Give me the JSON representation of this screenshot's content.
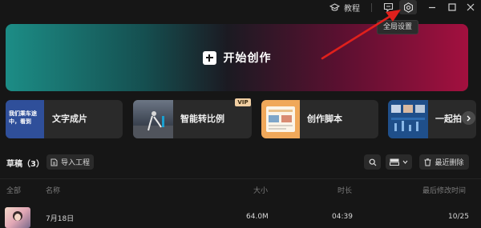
{
  "topbar": {
    "tutorial_label": "教程",
    "tooltip": "全局设置"
  },
  "banner": {
    "label": "开始创作"
  },
  "features": [
    {
      "thumb_text": "我们乘车途中，看到",
      "label": "文字成片"
    },
    {
      "label": "智能转比例",
      "badge": "VIP"
    },
    {
      "label": "创作脚本"
    },
    {
      "label": "一起拍"
    }
  ],
  "drafts": {
    "title": "草稿（3）",
    "import_label": "导入工程",
    "recent_delete_label": "最近删除"
  },
  "table": {
    "columns": [
      "全部",
      "名称",
      "大小",
      "时长",
      "最后修改时间"
    ],
    "rows": [
      {
        "name": "7月18日",
        "size": "64.0M",
        "duration": "04:39",
        "modified": "10/25"
      }
    ]
  },
  "colors": {
    "background": "#161616",
    "banner_left": "#1c8d86",
    "banner_right": "#a3103f",
    "annotation_arrow": "#e0201c",
    "vip_badge": "#f1cfa3"
  }
}
